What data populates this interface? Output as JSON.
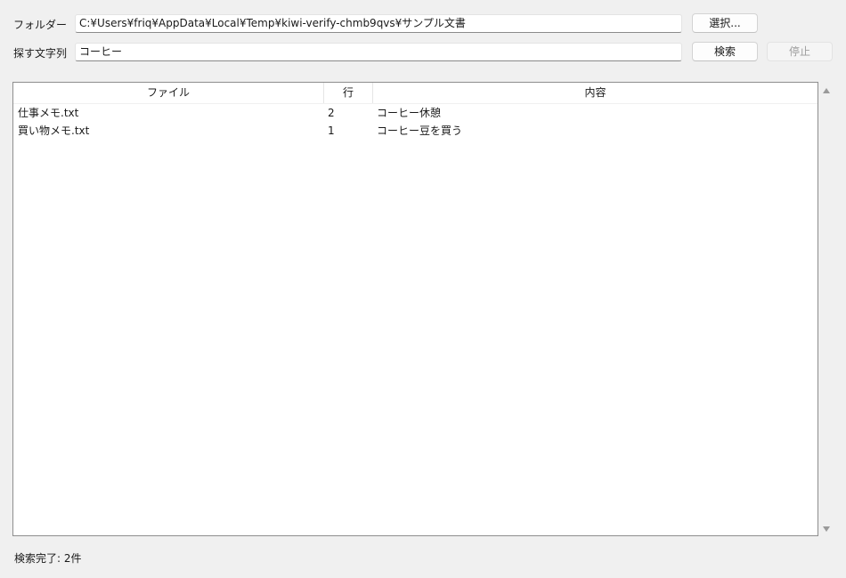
{
  "folder": {
    "label": "フォルダー",
    "value": "C:¥Users¥friq¥AppData¥Local¥Temp¥kiwi-verify-chmb9qvs¥サンプル文書",
    "select_button": "選択..."
  },
  "search": {
    "label": "探す文字列",
    "value": "コーヒー",
    "search_button": "検索",
    "stop_button": "停止"
  },
  "results": {
    "columns": [
      "ファイル",
      "行",
      "内容"
    ],
    "rows": [
      {
        "file": "仕事メモ.txt",
        "line": "2",
        "content": "コーヒー休憩"
      },
      {
        "file": "買い物メモ.txt",
        "line": "1",
        "content": "コーヒー豆を買う"
      }
    ]
  },
  "status": "検索完了: 2件",
  "icons": {
    "scroll_up": "triangle-up",
    "scroll_down": "triangle-down"
  }
}
